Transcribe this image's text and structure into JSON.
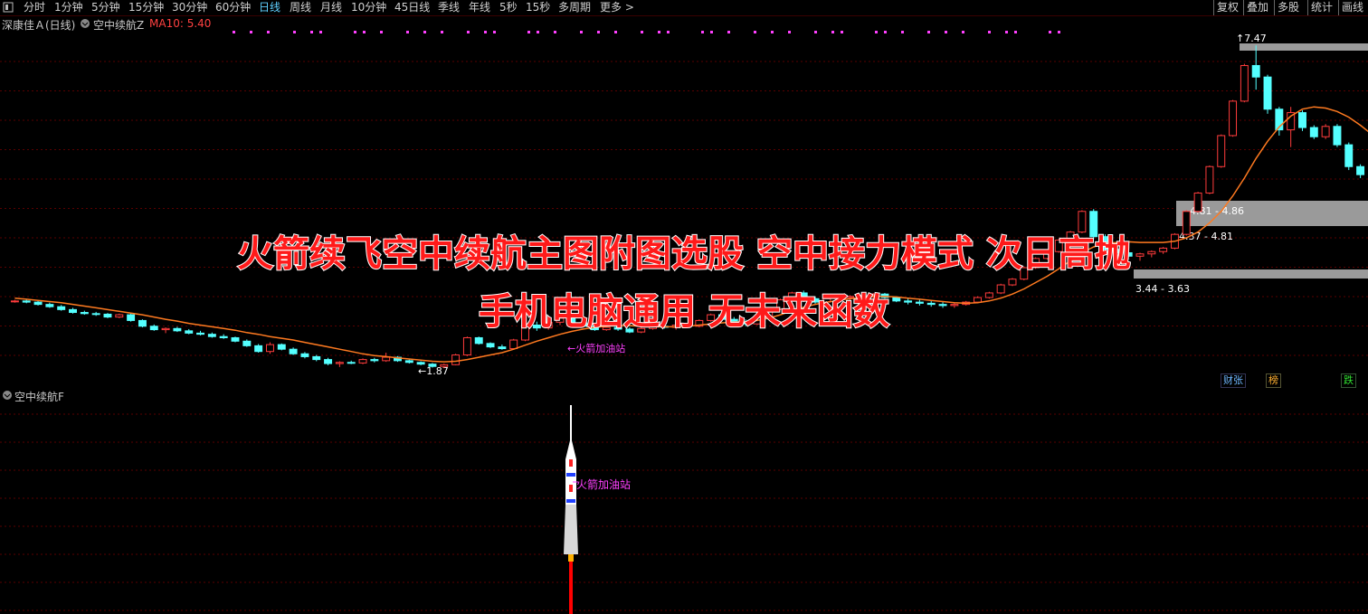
{
  "toolbar": {
    "menu_icon": "menu-icon",
    "periods": [
      "分时",
      "1分钟",
      "5分钟",
      "15分钟",
      "30分钟",
      "60分钟",
      "日线",
      "周线",
      "月线",
      "10分钟",
      "45日线",
      "季线",
      "年线",
      "5秒",
      "15秒",
      "多周期",
      "更多 >"
    ],
    "active_period": "日线",
    "right_buttons": [
      "复权",
      "叠加",
      "多股",
      "统计",
      "画线"
    ]
  },
  "main": {
    "stock_name": "深康佳Ａ(日线)",
    "indicator_name": "空中续航Z",
    "ma_label": "MA10: 5.40",
    "high_label": "7.47",
    "low_label": "1.87",
    "zone_labels": [
      "4.81 - 4.86",
      "4.37 - 4.81",
      "3.44 - 3.63"
    ],
    "marker_label": "火箭加油站",
    "badges": [
      "财张",
      "榜",
      "跌"
    ]
  },
  "sub": {
    "indicator_name": "空中续航F",
    "marker_label": "火箭加油站"
  },
  "overlay": {
    "line1": "火箭续飞空中续航主图附图选股 空中接力模式 次日高抛",
    "line2": "手机电脑通用 无未来函数"
  },
  "colors": {
    "background": "#000000",
    "up": "#ff3c3c",
    "down": "#54ffff",
    "ma_line": "#ff7a20",
    "grid": "#5a0000",
    "marker": "#ff40ff",
    "zone": "#9a9a9a"
  },
  "candles": [
    [
      3.01,
      3.04,
      2.99,
      3.02
    ],
    [
      3.02,
      3.05,
      2.98,
      3.0
    ],
    [
      3.0,
      3.02,
      2.94,
      2.96
    ],
    [
      2.96,
      2.99,
      2.9,
      2.92
    ],
    [
      2.92,
      2.95,
      2.85,
      2.87
    ],
    [
      2.87,
      2.9,
      2.8,
      2.82
    ],
    [
      2.82,
      2.85,
      2.78,
      2.8
    ],
    [
      2.8,
      2.83,
      2.76,
      2.79
    ],
    [
      2.79,
      2.81,
      2.72,
      2.74
    ],
    [
      2.74,
      2.8,
      2.72,
      2.78
    ],
    [
      2.78,
      2.8,
      2.66,
      2.68
    ],
    [
      2.68,
      2.7,
      2.56,
      2.58
    ],
    [
      2.58,
      2.61,
      2.5,
      2.52
    ],
    [
      2.52,
      2.56,
      2.46,
      2.54
    ],
    [
      2.54,
      2.57,
      2.48,
      2.5
    ],
    [
      2.5,
      2.53,
      2.44,
      2.46
    ],
    [
      2.46,
      2.5,
      2.42,
      2.44
    ],
    [
      2.44,
      2.47,
      2.38,
      2.4
    ],
    [
      2.4,
      2.44,
      2.36,
      2.38
    ],
    [
      2.38,
      2.4,
      2.3,
      2.32
    ],
    [
      2.32,
      2.35,
      2.22,
      2.24
    ],
    [
      2.24,
      2.27,
      2.12,
      2.14
    ],
    [
      2.14,
      2.3,
      2.1,
      2.26
    ],
    [
      2.26,
      2.28,
      2.16,
      2.18
    ],
    [
      2.18,
      2.21,
      2.08,
      2.1
    ],
    [
      2.1,
      2.13,
      2.02,
      2.05
    ],
    [
      2.05,
      2.08,
      1.97,
      2.0
    ],
    [
      2.0,
      2.03,
      1.9,
      1.93
    ],
    [
      1.93,
      1.97,
      1.87,
      1.95
    ],
    [
      1.95,
      1.98,
      1.92,
      1.94
    ],
    [
      1.94,
      2.02,
      1.92,
      2.0
    ],
    [
      2.0,
      2.03,
      1.95,
      1.98
    ],
    [
      1.98,
      2.12,
      1.96,
      2.04
    ],
    [
      2.04,
      2.06,
      1.96,
      1.98
    ],
    [
      1.98,
      2.0,
      1.93,
      1.95
    ],
    [
      1.95,
      1.97,
      1.9,
      1.92
    ],
    [
      1.92,
      1.94,
      1.86,
      1.88
    ],
    [
      1.88,
      1.93,
      1.85,
      1.91
    ],
    [
      1.91,
      2.1,
      1.9,
      2.08
    ],
    [
      2.08,
      2.4,
      2.06,
      2.38
    ],
    [
      2.38,
      2.4,
      2.26,
      2.28
    ],
    [
      2.28,
      2.3,
      2.2,
      2.22
    ],
    [
      2.22,
      2.26,
      2.17,
      2.19
    ],
    [
      2.19,
      2.36,
      2.17,
      2.34
    ],
    [
      2.34,
      2.62,
      2.32,
      2.6
    ],
    [
      2.6,
      2.66,
      2.5,
      2.55
    ],
    [
      2.55,
      2.68,
      2.52,
      2.65
    ],
    [
      2.65,
      2.74,
      2.6,
      2.72
    ],
    [
      2.72,
      2.74,
      2.62,
      2.64
    ],
    [
      2.64,
      2.66,
      2.56,
      2.58
    ],
    [
      2.58,
      2.6,
      2.5,
      2.52
    ],
    [
      2.52,
      2.58,
      2.5,
      2.56
    ],
    [
      2.56,
      2.6,
      2.5,
      2.53
    ],
    [
      2.53,
      2.56,
      2.46,
      2.48
    ],
    [
      2.48,
      2.56,
      2.46,
      2.54
    ],
    [
      2.54,
      2.6,
      2.52,
      2.58
    ],
    [
      2.58,
      2.62,
      2.54,
      2.56
    ],
    [
      2.56,
      2.62,
      2.52,
      2.6
    ],
    [
      2.6,
      2.64,
      2.56,
      2.58
    ],
    [
      2.58,
      2.7,
      2.56,
      2.68
    ],
    [
      2.68,
      2.8,
      2.66,
      2.78
    ],
    [
      2.78,
      2.82,
      2.68,
      2.7
    ],
    [
      2.7,
      2.74,
      2.62,
      2.66
    ],
    [
      2.66,
      2.7,
      2.58,
      2.62
    ],
    [
      2.62,
      2.76,
      2.6,
      2.74
    ],
    [
      2.74,
      2.9,
      2.72,
      2.88
    ],
    [
      2.88,
      3.06,
      2.86,
      3.04
    ],
    [
      3.04,
      3.18,
      3.02,
      3.16
    ],
    [
      3.16,
      3.2,
      3.0,
      3.06
    ],
    [
      3.06,
      3.1,
      2.96,
      3.0
    ],
    [
      3.0,
      3.08,
      2.96,
      3.06
    ],
    [
      3.06,
      3.1,
      3.0,
      3.08
    ],
    [
      3.08,
      3.12,
      3.02,
      3.1
    ],
    [
      3.1,
      3.14,
      3.04,
      3.12
    ],
    [
      3.12,
      3.16,
      3.06,
      3.14
    ],
    [
      3.14,
      3.16,
      3.06,
      3.08
    ],
    [
      3.08,
      3.1,
      3.0,
      3.02
    ],
    [
      3.02,
      3.06,
      2.96,
      3.0
    ],
    [
      3.0,
      3.04,
      2.94,
      2.98
    ],
    [
      2.98,
      3.02,
      2.92,
      2.96
    ],
    [
      2.96,
      3.0,
      2.9,
      2.94
    ],
    [
      2.94,
      2.98,
      2.9,
      2.96
    ],
    [
      2.96,
      3.02,
      2.94,
      3.0
    ],
    [
      3.0,
      3.1,
      2.98,
      3.08
    ],
    [
      3.08,
      3.18,
      3.06,
      3.16
    ],
    [
      3.16,
      3.32,
      3.14,
      3.3
    ],
    [
      3.3,
      3.42,
      3.28,
      3.4
    ],
    [
      3.4,
      3.62,
      3.38,
      3.6
    ],
    [
      3.6,
      3.78,
      3.58,
      3.76
    ],
    [
      3.76,
      3.9,
      3.74,
      3.88
    ],
    [
      3.88,
      4.1,
      3.86,
      4.08
    ],
    [
      4.08,
      4.24,
      4.06,
      4.22
    ],
    [
      4.22,
      4.6,
      4.2,
      4.58
    ],
    [
      4.58,
      4.62,
      4.1,
      4.14
    ],
    [
      4.14,
      4.18,
      3.86,
      3.92
    ],
    [
      3.92,
      3.96,
      3.82,
      3.86
    ],
    [
      3.86,
      3.9,
      3.74,
      3.8
    ],
    [
      3.8,
      3.86,
      3.72,
      3.84
    ],
    [
      3.84,
      3.9,
      3.78,
      3.88
    ],
    [
      3.88,
      3.96,
      3.84,
      3.94
    ],
    [
      3.94,
      4.2,
      3.92,
      4.18
    ],
    [
      4.18,
      4.6,
      4.16,
      4.58
    ],
    [
      4.58,
      4.92,
      4.56,
      4.9
    ],
    [
      4.9,
      5.38,
      4.88,
      5.36
    ],
    [
      5.36,
      5.92,
      5.34,
      5.9
    ],
    [
      5.9,
      6.52,
      5.88,
      6.5
    ],
    [
      6.5,
      7.15,
      6.48,
      7.12
    ],
    [
      7.12,
      7.47,
      6.7,
      6.92
    ],
    [
      6.92,
      6.96,
      6.28,
      6.36
    ],
    [
      6.36,
      6.4,
      5.9,
      6.0
    ],
    [
      6.0,
      6.4,
      5.7,
      6.3
    ],
    [
      6.3,
      6.34,
      5.98,
      6.04
    ],
    [
      6.04,
      6.08,
      5.84,
      5.88
    ],
    [
      5.88,
      6.1,
      5.84,
      6.06
    ],
    [
      6.06,
      6.1,
      5.7,
      5.74
    ],
    [
      5.74,
      5.78,
      5.3,
      5.36
    ],
    [
      5.36,
      5.4,
      5.16,
      5.22
    ]
  ],
  "ma10": [
    3.07,
    3.05,
    3.03,
    3.01,
    2.99,
    2.96,
    2.93,
    2.9,
    2.87,
    2.84,
    2.81,
    2.78,
    2.74,
    2.7,
    2.67,
    2.63,
    2.6,
    2.57,
    2.54,
    2.51,
    2.47,
    2.44,
    2.4,
    2.37,
    2.34,
    2.3,
    2.26,
    2.22,
    2.18,
    2.14,
    2.1,
    2.07,
    2.05,
    2.03,
    2.01,
    1.99,
    1.97,
    1.96,
    1.97,
    2.0,
    2.04,
    2.08,
    2.12,
    2.18,
    2.25,
    2.32,
    2.38,
    2.44,
    2.49,
    2.53,
    2.56,
    2.58,
    2.59,
    2.59,
    2.58,
    2.57,
    2.57,
    2.57,
    2.58,
    2.6,
    2.62,
    2.64,
    2.65,
    2.66,
    2.68,
    2.72,
    2.78,
    2.85,
    2.91,
    2.96,
    3.0,
    3.03,
    3.06,
    3.08,
    3.1,
    3.1,
    3.09,
    3.07,
    3.05,
    3.03,
    3.01,
    2.99,
    2.98,
    2.99,
    3.02,
    3.07,
    3.14,
    3.23,
    3.34,
    3.45,
    3.58,
    3.72,
    3.86,
    3.96,
    4.02,
    4.04,
    4.05,
    4.04,
    4.04,
    4.04,
    4.06,
    4.12,
    4.22,
    4.38,
    4.58,
    4.85,
    5.16,
    5.5,
    5.8,
    6.05,
    6.24,
    6.36,
    6.4,
    6.38,
    6.32,
    6.22,
    6.08,
    5.92
  ]
}
